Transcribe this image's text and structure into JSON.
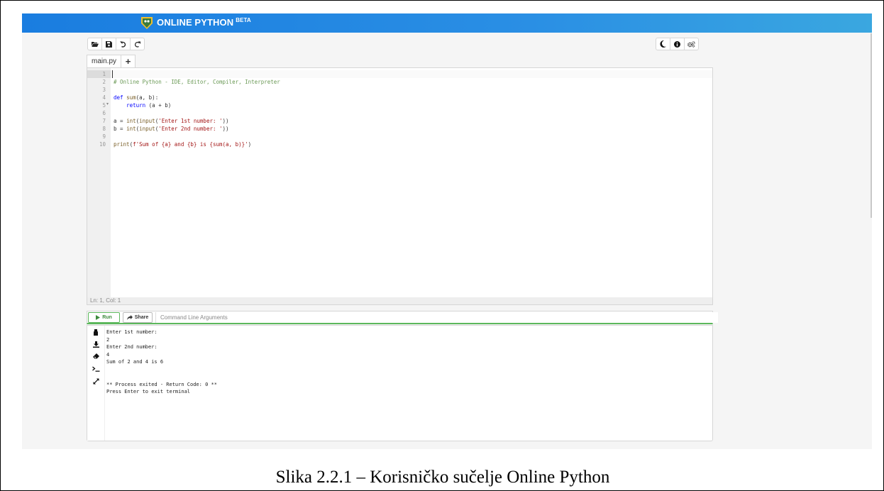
{
  "header": {
    "app_title": "ONLINE PYTHON",
    "badge": "BETA"
  },
  "toolbar_left": [
    {
      "name": "open-folder",
      "icon": "folder-open-icon"
    },
    {
      "name": "save",
      "icon": "save-icon"
    },
    {
      "name": "undo",
      "icon": "undo-icon"
    },
    {
      "name": "redo",
      "icon": "redo-icon"
    }
  ],
  "toolbar_right": [
    {
      "name": "dark-mode",
      "icon": "moon-icon"
    },
    {
      "name": "info",
      "icon": "info-icon"
    },
    {
      "name": "settings",
      "icon": "gears-icon"
    }
  ],
  "tabs": {
    "file": "main.py",
    "add": "+"
  },
  "editor": {
    "line_numbers": [
      "1",
      "2",
      "3",
      "4",
      "5",
      "6",
      "7",
      "8",
      "9",
      "10"
    ],
    "code_lines": [
      "",
      "# Online Python - IDE, Editor, Compiler, Interpreter",
      "",
      "def sum(a, b):",
      "    return (a + b)",
      "",
      "a = int(input('Enter 1st number: '))",
      "b = int(input('Enter 2nd number: '))",
      "",
      "print(f'Sum of {a} and {b} is {sum(a, b)}')"
    ],
    "status": "Ln: 1,  Col: 1"
  },
  "actions": {
    "run_label": "Run",
    "share_label": "Share",
    "args_placeholder": "Command Line Arguments"
  },
  "terminal": {
    "side_icons": [
      "stop-icon",
      "download-icon",
      "eraser-icon",
      "terminal-icon",
      "expand-icon"
    ],
    "output_lines": [
      "Enter 1st number:",
      "2",
      "Enter 2nd number:",
      "4",
      "Sum of 2 and 4 is 6",
      "",
      "",
      "** Process exited - Return Code: 0 **",
      "Press Enter to exit terminal"
    ]
  },
  "caption": "Slika 2.2.1 – Korisničko sučelje Online Python",
  "colors": {
    "banner_start": "#1a7de0",
    "banner_end": "#3aa7e0",
    "run_green": "#5cb85c",
    "comment": "#6a9955",
    "keyword": "#0000ff",
    "string": "#a31515",
    "number": "#098658",
    "function": "#795e26"
  }
}
